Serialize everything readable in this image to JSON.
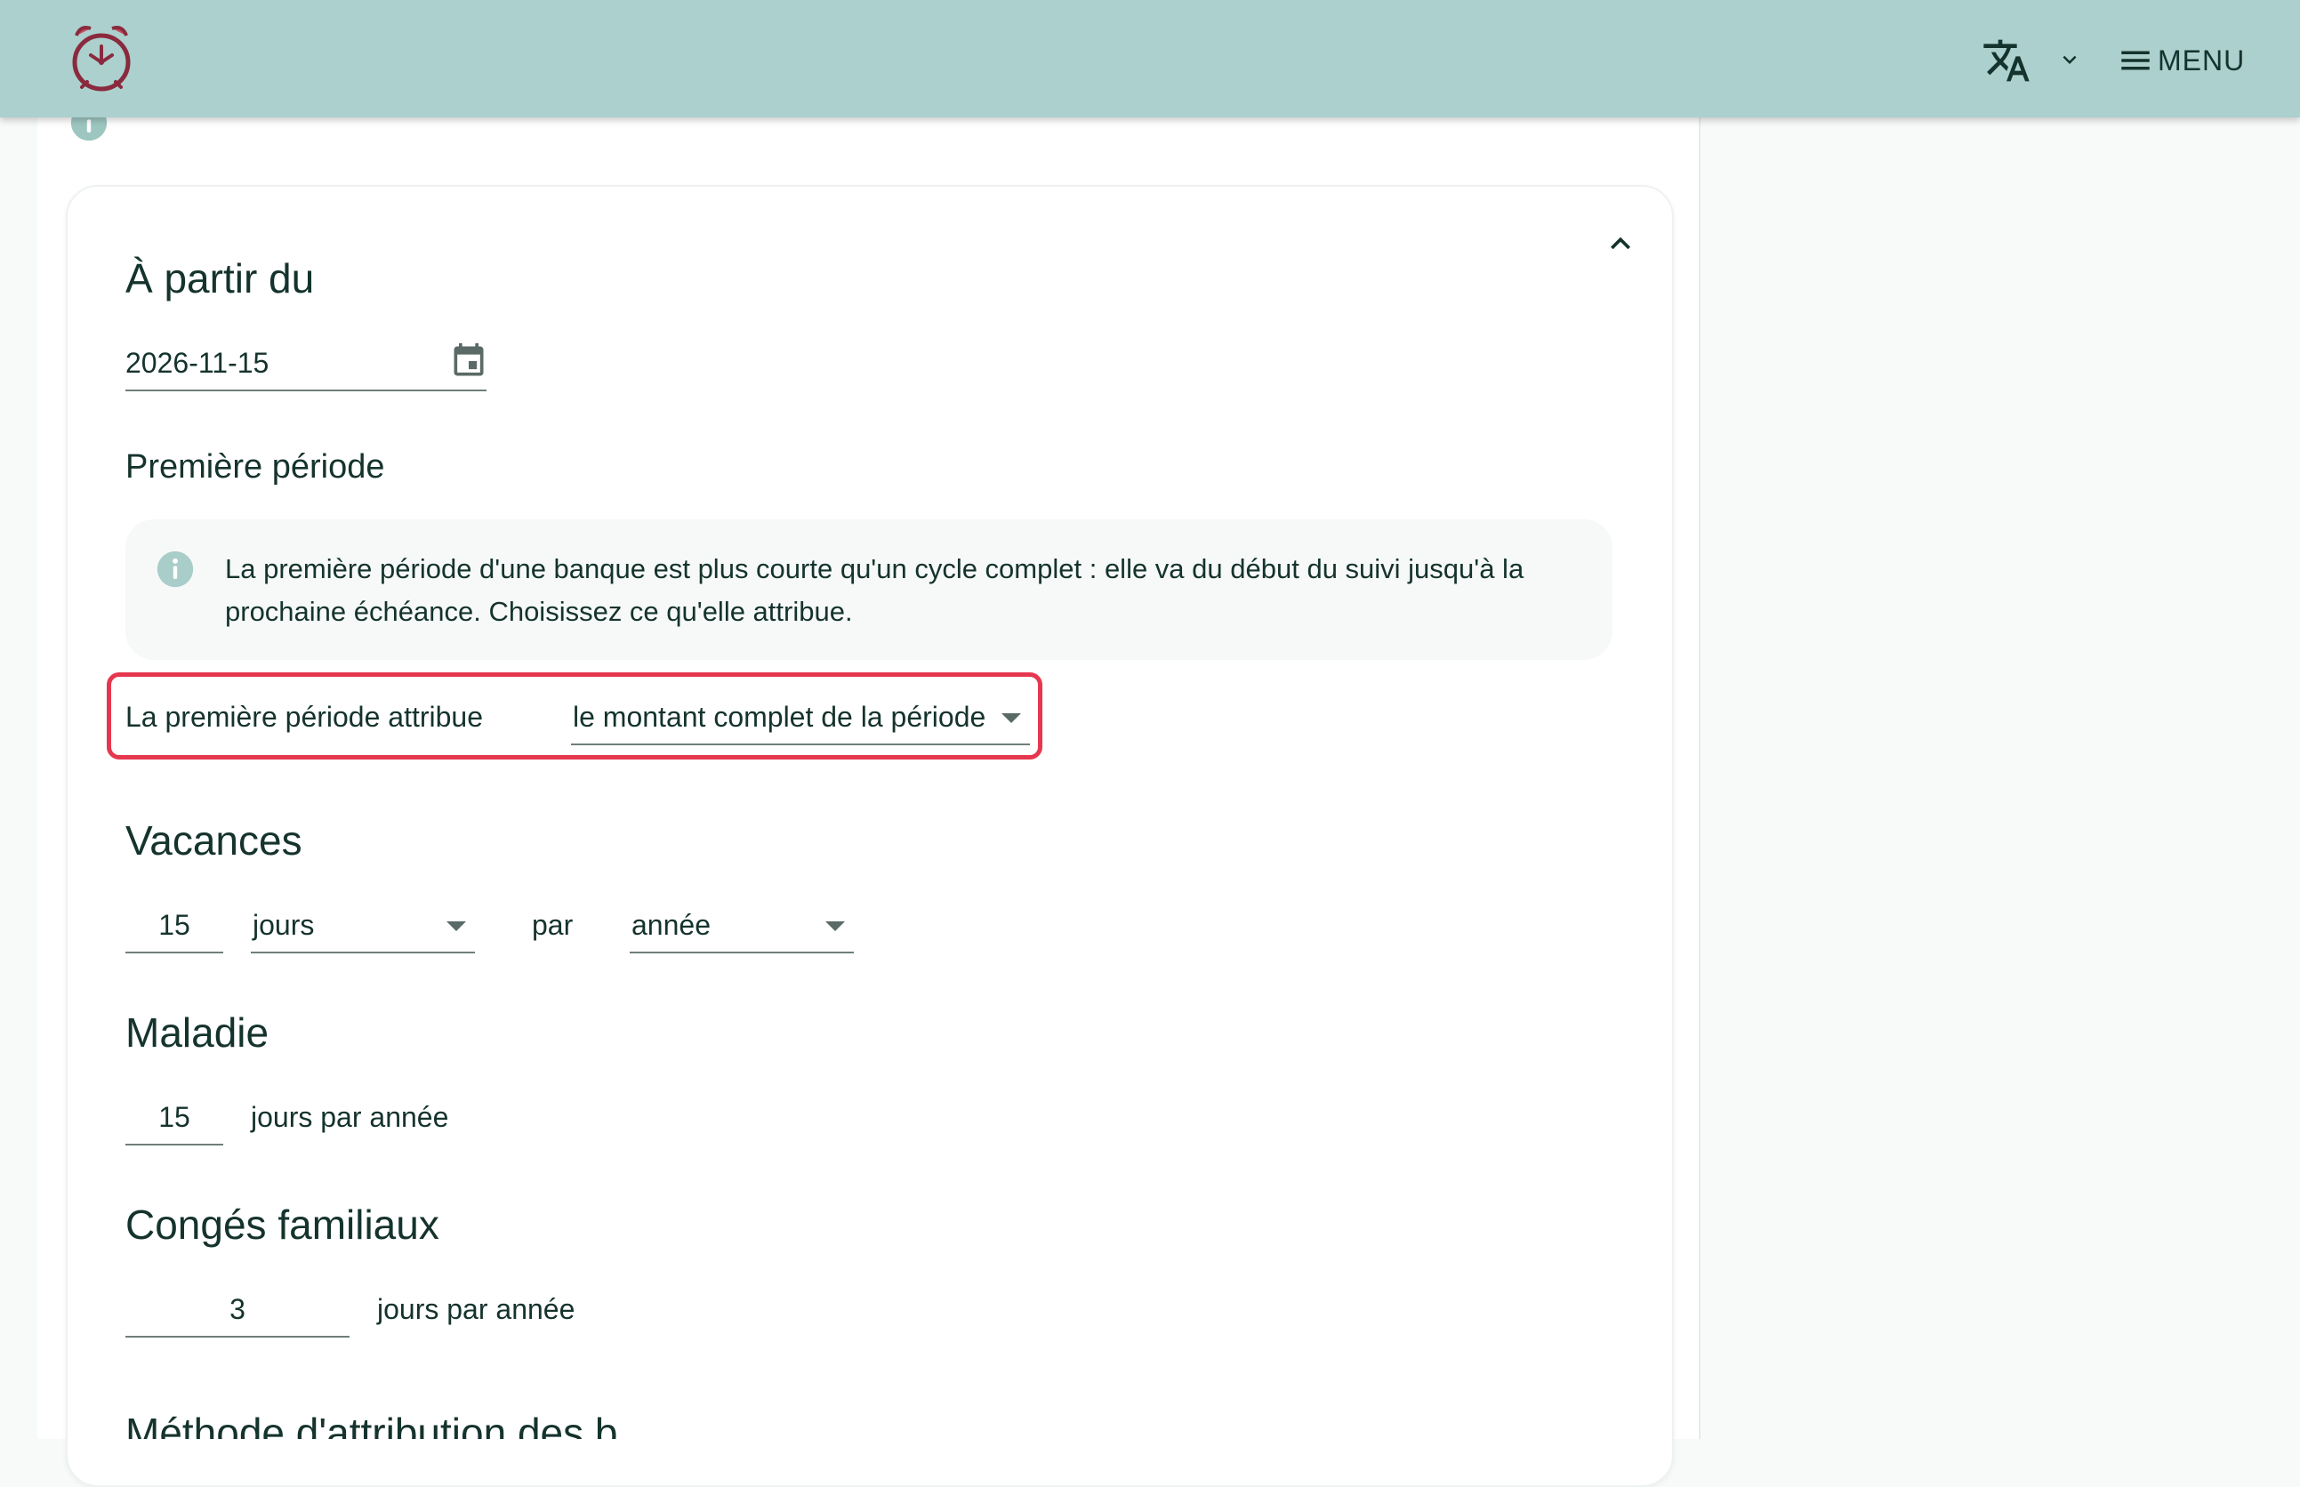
{
  "header": {
    "logo_icon": "alarm-clock-icon",
    "translate_icon": "translate-icon",
    "menu_label": "MENU",
    "bar_color": "#abd0cd"
  },
  "form": {
    "start_section": {
      "title": "À partir du",
      "date_value": "2026-11-15"
    },
    "first_period": {
      "title": "Première période",
      "info_text": "La première période d'une banque est plus courte qu'un cycle complet : elle va du début du suivi jusqu'à la prochaine échéance. Choisissez ce qu'elle attribue.",
      "attr_label": "La première période attribue",
      "attr_value": "le montant complet de la période",
      "highlight_color": "#e5384f"
    },
    "vacation": {
      "title": "Vacances",
      "amount": "15",
      "unit": "jours",
      "per_label": "par",
      "period": "année"
    },
    "sickness": {
      "title": "Maladie",
      "amount": "15",
      "suffix": "jours par année"
    },
    "family": {
      "title": "Congés familiaux",
      "amount": "3",
      "suffix": "jours par année"
    },
    "next_section_partial": "Méthode d'attribution des b"
  }
}
